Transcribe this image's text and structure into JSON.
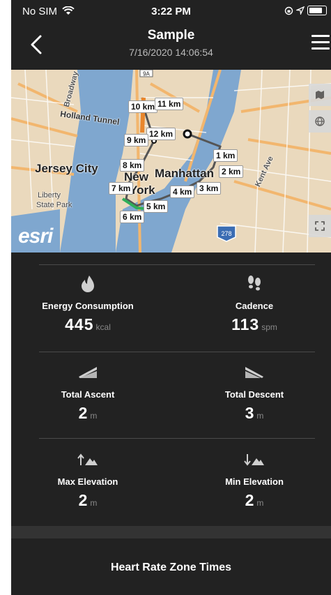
{
  "status_bar": {
    "carrier": "No SIM",
    "time": "3:22 PM"
  },
  "header": {
    "title": "Sample",
    "subtitle": "7/16/2020 14:06:54"
  },
  "map": {
    "places": [
      "Jersey City",
      "New",
      "Manhattan",
      "York",
      "Liberty",
      "State Park",
      "Holland Tunnel",
      "Broadway",
      "Kent Ave"
    ],
    "km_markers": [
      "10 km",
      "11 km",
      "12 km",
      "9 km",
      "8 km",
      "7 km",
      "1 km",
      "2 km",
      "3 km",
      "4 km",
      "5 km",
      "6 km"
    ],
    "attribution": "esri",
    "highway_shield": "278",
    "route_shield": "9A"
  },
  "stats": [
    {
      "label": "Energy Consumption",
      "value": "445",
      "unit": "kcal",
      "icon": "flame-icon"
    },
    {
      "label": "Cadence",
      "value": "113",
      "unit": "spm",
      "icon": "footprints-icon"
    },
    {
      "label": "Total Ascent",
      "value": "2",
      "unit": "m",
      "icon": "ascent-icon"
    },
    {
      "label": "Total Descent",
      "value": "3",
      "unit": "m",
      "icon": "descent-icon"
    },
    {
      "label": "Max Elevation",
      "value": "2",
      "unit": "m",
      "icon": "max-elevation-icon"
    },
    {
      "label": "Min Elevation",
      "value": "2",
      "unit": "m",
      "icon": "min-elevation-icon"
    }
  ],
  "section_title": "Heart Rate Zone Times"
}
